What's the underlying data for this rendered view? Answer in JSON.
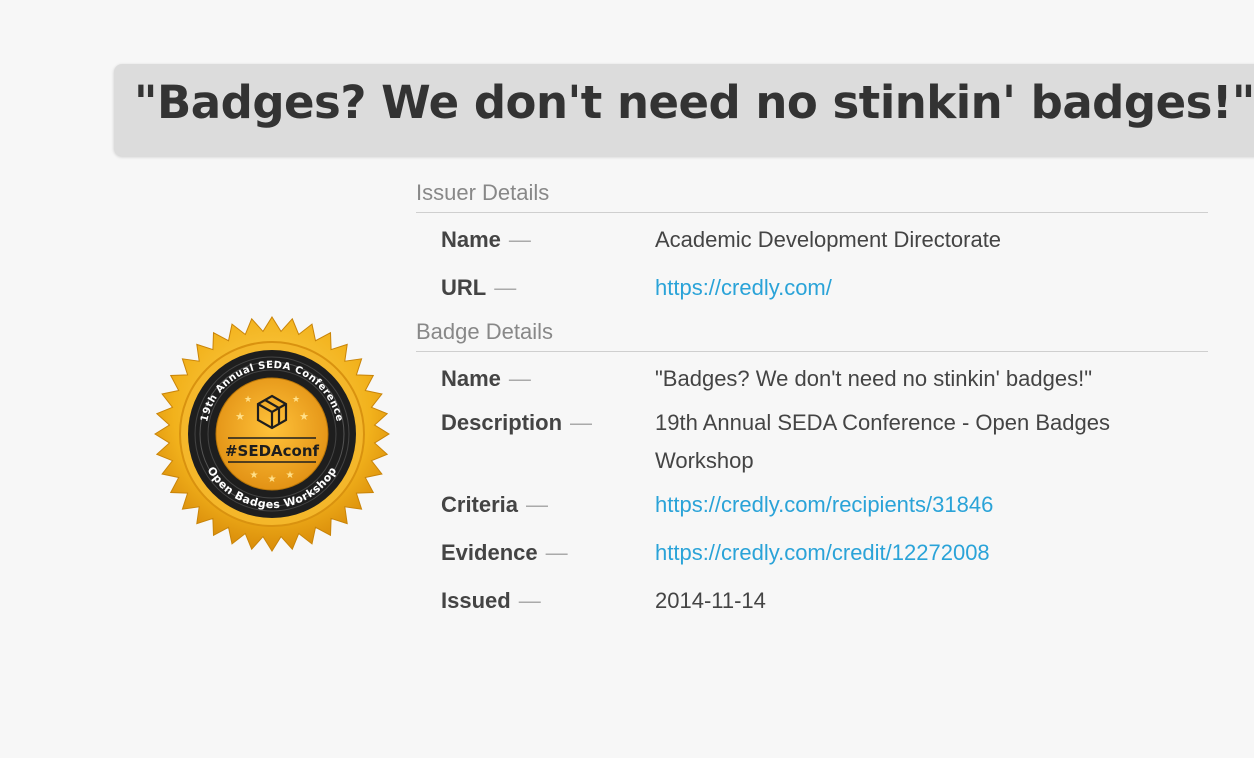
{
  "title": "\"Badges? We don't need no stinkin' badges!\"",
  "badge_image": {
    "top_text": "19th Annual SEDA Conference",
    "center_text": "#SEDAconf",
    "bottom_text": "Open Badges Workshop",
    "colors": {
      "gold": "#f2b21c",
      "gold_dark": "#d98c0a",
      "ring": "#222222",
      "ring_stripe": "#555555",
      "inner": "#eea020"
    }
  },
  "issuer_details": {
    "header": "Issuer Details",
    "rows": [
      {
        "label": "Name",
        "dash": "—",
        "value": "Academic Development Directorate",
        "is_link": false
      },
      {
        "label": "URL",
        "dash": "—",
        "value": "https://credly.com/",
        "is_link": true
      }
    ]
  },
  "badge_details": {
    "header": "Badge Details",
    "rows": [
      {
        "label": "Name",
        "dash": "—",
        "value": "\"Badges? We don't need no stinkin' badges!\"",
        "is_link": false
      },
      {
        "label": "Description",
        "dash": "—",
        "value": "19th Annual SEDA Conference - Open Badges Workshop",
        "is_link": false
      },
      {
        "label": "Criteria",
        "dash": "—",
        "value": "https://credly.com/recipients/31846",
        "is_link": true
      },
      {
        "label": "Evidence",
        "dash": "—",
        "value": "https://credly.com/credit/12272008",
        "is_link": true
      },
      {
        "label": "Issued",
        "dash": "—",
        "value": "2014-11-14",
        "is_link": false
      }
    ]
  },
  "colors": {
    "link": "#2aa3d8",
    "title_bar": "#dcdcdc",
    "background": "#f7f7f7"
  }
}
